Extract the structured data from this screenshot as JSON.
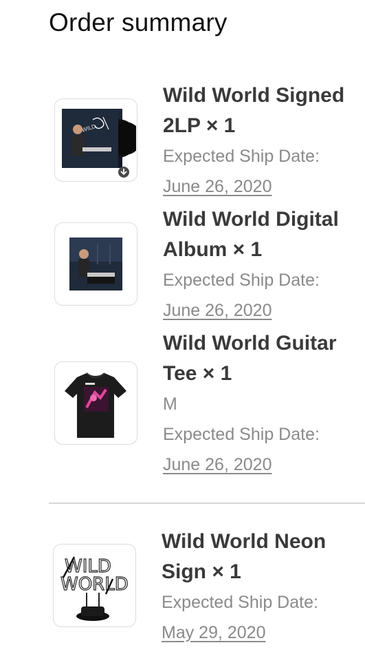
{
  "page": {
    "title": "Order summary"
  },
  "items": [
    {
      "name": "Wild World Signed 2LP × 1",
      "variant": "",
      "ship_label": "Expected Ship Date:",
      "ship_date": "June 26, 2020",
      "icon": "signed-vinyl-thumbnail"
    },
    {
      "name": "Wild World Digital Album × 1",
      "variant": "",
      "ship_label": "Expected Ship Date:",
      "ship_date": "June 26, 2020",
      "icon": "album-cover-thumbnail"
    },
    {
      "name": "Wild World Guitar Tee × 1",
      "variant": "M",
      "ship_label": "Expected Ship Date:",
      "ship_date": "June 26, 2020",
      "icon": "tshirt-thumbnail"
    },
    {
      "name": "Wild World Neon Sign × 1",
      "variant": "",
      "ship_label": "Expected Ship Date:",
      "ship_date": "May 29, 2020",
      "icon": "neon-sign-thumbnail"
    }
  ],
  "colors": {
    "text_dark": "#3a3a3a",
    "text_muted": "#8a8a8a",
    "border": "#dcdcdc"
  }
}
